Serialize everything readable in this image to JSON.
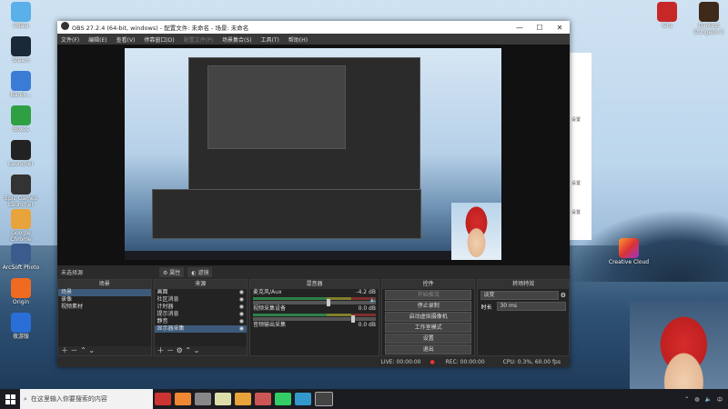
{
  "desktop": {
    "icons_left": [
      {
        "label": "Udala",
        "color": "#5ab0e8"
      },
      {
        "label": "Steam",
        "color": "#1b2838"
      },
      {
        "label": "Bandi...",
        "color": "#3a7bd5"
      },
      {
        "label": "Boxes",
        "color": "#2ea043"
      },
      {
        "label": "Launcher",
        "color": "#222"
      },
      {
        "label": "Epic Games Launcher",
        "color": "#333"
      },
      {
        "label": "Google Chrome",
        "color": "#e8a33a"
      },
      {
        "label": "ArcSoft Photo",
        "color": "#3b5b8c"
      },
      {
        "label": "Origin",
        "color": "#f06a22"
      },
      {
        "label": "夜游版",
        "color": "#2a6ed8"
      }
    ],
    "icons_right": [
      {
        "label": "Sifu",
        "color": "#c62828"
      },
      {
        "label": "Darkest Dungeon II",
        "color": "#3e2a1a"
      }
    ],
    "creative_cloud_label": "Creative Cloud"
  },
  "obs": {
    "title": "OBS 27.2.4 (64-bit, windows) - 配置文件: 未命名 - 场景: 未命名",
    "menu": [
      {
        "label": "文件(F)",
        "enabled": true
      },
      {
        "label": "编辑(E)",
        "enabled": true
      },
      {
        "label": "查看(V)",
        "enabled": true
      },
      {
        "label": "停靠窗口(D)",
        "enabled": true
      },
      {
        "label": "配置文件(P)",
        "enabled": false
      },
      {
        "label": "场景集合(S)",
        "enabled": true
      },
      {
        "label": "工具(T)",
        "enabled": true
      },
      {
        "label": "帮助(H)",
        "enabled": true
      }
    ],
    "status_row": {
      "selected": "未选择源",
      "properties": "属性",
      "filters": "滤镜"
    },
    "scenes": {
      "header": "场景",
      "items": [
        "场景",
        "录像",
        "视频素材"
      ]
    },
    "sources": {
      "header": "来源",
      "items": [
        "画面",
        "社区消息",
        "计时器",
        "提示消息",
        "静音",
        "显示器采集"
      ]
    },
    "mixer": {
      "header": "混音器",
      "channels": [
        {
          "name": "麦克风/Aux",
          "db": "-4.2 dB"
        },
        {
          "name": "视频采集设备",
          "db": "0.0 dB"
        },
        {
          "name": "音频输出采集",
          "db": "0.0 dB"
        }
      ]
    },
    "controls": {
      "header": "控件",
      "buttons": [
        {
          "label": "开始推流",
          "enabled": false
        },
        {
          "label": "停止录制",
          "enabled": true
        },
        {
          "label": "启动虚拟摄像机",
          "enabled": true
        },
        {
          "label": "工作室模式",
          "enabled": true
        },
        {
          "label": "设置",
          "enabled": true
        },
        {
          "label": "退出",
          "enabled": true
        }
      ]
    },
    "transitions": {
      "header": "转场特效",
      "type": "淡变",
      "duration_label": "时长",
      "duration": "30 ms"
    },
    "statusbar": {
      "live": "LIVE: 00:00:00",
      "rec": "REC: 00:00:00",
      "cpu": "CPU: 0.3%, 60.00 fps"
    }
  },
  "dialog": {
    "items": [
      "设置",
      "设置",
      "设置"
    ]
  },
  "taskbar": {
    "search_placeholder": "在这里输入你要搜索的内容",
    "time": "",
    "date": ""
  }
}
